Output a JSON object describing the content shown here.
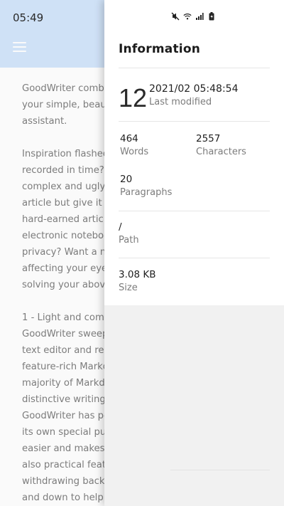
{
  "background_app": {
    "status_time": "05:49",
    "paragraphs": [
      [
        "GoodWriter combin",
        "your simple, beaut",
        "assistant."
      ],
      [
        "Inspiration flashed",
        "recorded in time? L",
        "complex and ugly w",
        "article but give it up",
        "hard-earned articl",
        "electronic noteboo",
        "privacy? Want a ni",
        "affecting your eyes",
        "solving your above"
      ],
      [
        "1 - Light and comp",
        "GoodWriter sweeps",
        "text editor and rep",
        "feature-rich Markd",
        "majority of Markdo",
        "distinctive writing “",
        "GoodWriter has po",
        "its own special pun",
        "easier and makes y",
        "also practical featu",
        "withdrawing back,",
        "and down to help y"
      ]
    ]
  },
  "drawer": {
    "title": "Information",
    "date": {
      "day": "12",
      "datetime": "2021/02 05:48:54",
      "label": "Last modified"
    },
    "words": {
      "value": "464",
      "label": "Words"
    },
    "characters": {
      "value": "2557",
      "label": "Characters"
    },
    "paragraphs": {
      "value": "20",
      "label": "Paragraphs"
    },
    "path": {
      "value": "/",
      "label": "Path"
    },
    "size": {
      "value": "3.08 KB",
      "label": "Size"
    }
  },
  "status_icons": [
    "mute-icon",
    "wifi-icon",
    "signal-icon",
    "battery-icon"
  ]
}
